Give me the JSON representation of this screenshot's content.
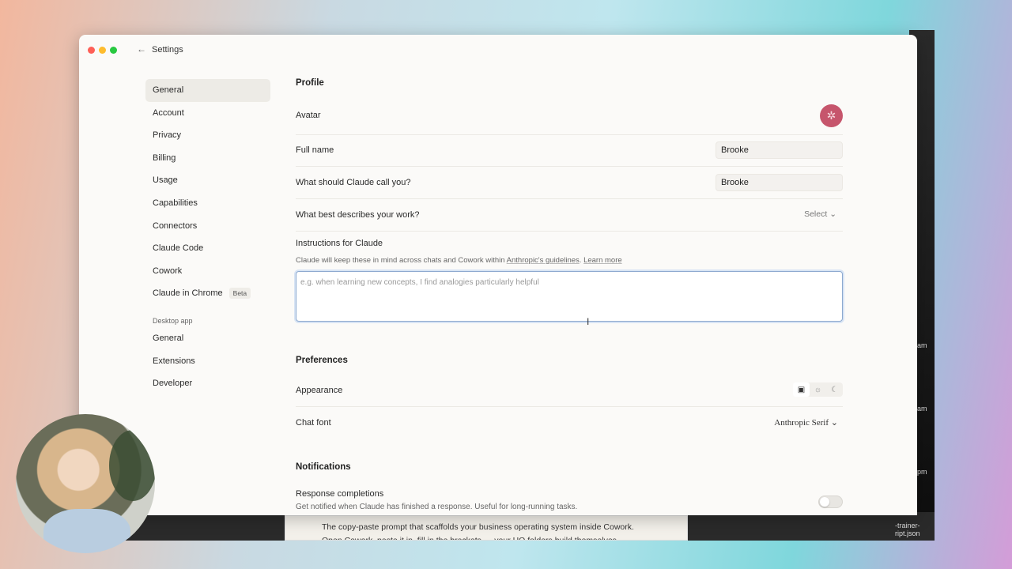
{
  "window": {
    "title": "Settings"
  },
  "sidebar": {
    "items": [
      {
        "label": "General",
        "active": true
      },
      {
        "label": "Account"
      },
      {
        "label": "Privacy"
      },
      {
        "label": "Billing"
      },
      {
        "label": "Usage"
      },
      {
        "label": "Capabilities"
      },
      {
        "label": "Connectors"
      },
      {
        "label": "Claude Code"
      },
      {
        "label": "Cowork"
      },
      {
        "label": "Claude in Chrome",
        "badge": "Beta"
      }
    ],
    "desktop_section_label": "Desktop app",
    "desktop_items": [
      {
        "label": "General"
      },
      {
        "label": "Extensions"
      },
      {
        "label": "Developer"
      }
    ]
  },
  "profile": {
    "heading": "Profile",
    "avatar_label": "Avatar",
    "full_name_label": "Full name",
    "full_name_value": "Brooke",
    "call_you_label": "What should Claude call you?",
    "call_you_value": "Brooke",
    "work_label": "What best describes your work?",
    "work_select": "Select",
    "instructions_label": "Instructions for Claude",
    "instructions_help": "Claude will keep these in mind across chats and Cowork within",
    "instructions_link": "Anthropic's guidelines",
    "instructions_learn_more": "Learn more",
    "instructions_placeholder": "e.g. when learning new concepts, I find analogies particularly helpful"
  },
  "preferences": {
    "heading": "Preferences",
    "appearance_label": "Appearance",
    "appearance_options": [
      "system-icon",
      "sun-icon",
      "moon-icon"
    ],
    "chat_font_label": "Chat font",
    "chat_font_value": "Anthropic Serif"
  },
  "notifications": {
    "heading": "Notifications",
    "response_label": "Response completions",
    "response_help": "Get notified when Claude has finished a response. Useful for long-running tasks.",
    "response_enabled": false
  },
  "background": {
    "card_line1": "The copy-paste prompt that scaffolds your business operating system inside Cowork.",
    "card_line2": "Open Cowork, paste it in, fill in the brackets — your HQ folders build themselves.",
    "side_am1": "am",
    "side_am2": "am",
    "side_pm": "pm",
    "side_file": "-trainer-ript.json"
  },
  "colors": {
    "avatar": "#c6556c",
    "focus_border": "#8da9cf"
  }
}
